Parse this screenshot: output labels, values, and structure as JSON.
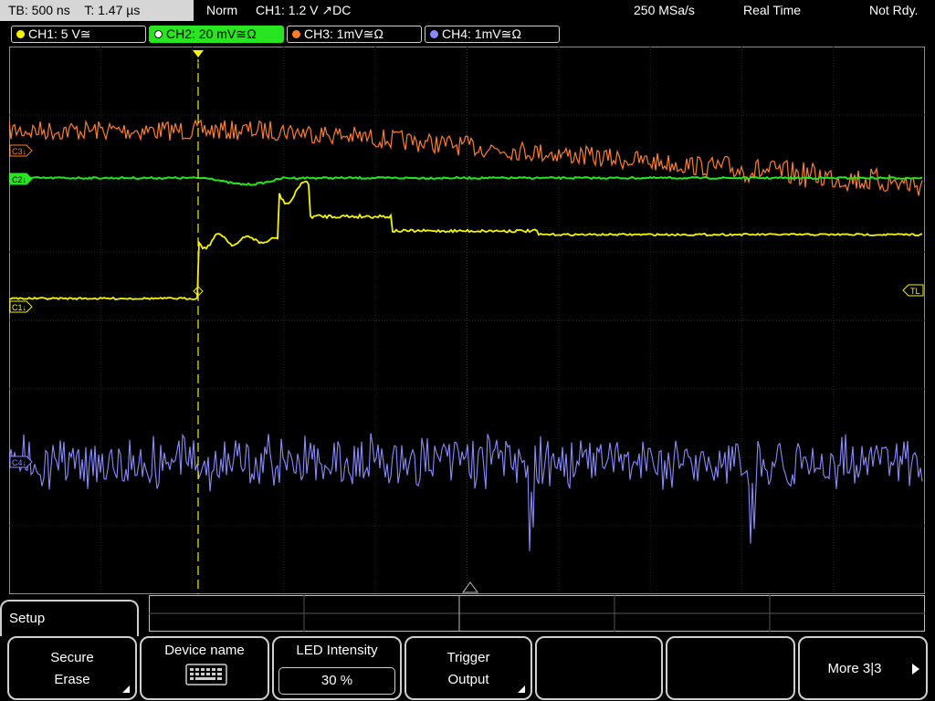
{
  "status": {
    "timebase": "TB: 500 ns",
    "trigger_time": "T: 1.47 µs",
    "mode": "Norm",
    "trigger_info": "CH1: 1.2 V ↗DC",
    "sample_rate": "250 MSa/s",
    "acq_mode": "Real Time",
    "ready": "Not Rdy."
  },
  "channels": [
    {
      "label": "CH1: 5 V≅",
      "color": "#f5f500"
    },
    {
      "label": "CH2: 20 mV≅Ω",
      "color": "#27e51e"
    },
    {
      "label": "CH3: 1mV≅Ω",
      "color": "#ff7f24"
    },
    {
      "label": "CH4: 1mV≅Ω",
      "color": "#8a8aff"
    }
  ],
  "markers": {
    "c3": "C3↓",
    "c2": "C2↓",
    "c1": "C1↓",
    "c4": "C4↓",
    "trigger_level": "TL",
    "trigger_pos": "T"
  },
  "menu": {
    "title": "Setup",
    "softkeys": [
      {
        "line1": "Secure",
        "line2": "Erase"
      },
      {
        "line1": "Device name",
        "icon": "keyboard-icon"
      },
      {
        "line1": "LED Intensity",
        "value": "30 %"
      },
      {
        "line1": "Trigger",
        "line2": "Output"
      },
      {
        "line1": ""
      },
      {
        "line1": ""
      },
      {
        "line1": "More 3|3"
      }
    ]
  }
}
